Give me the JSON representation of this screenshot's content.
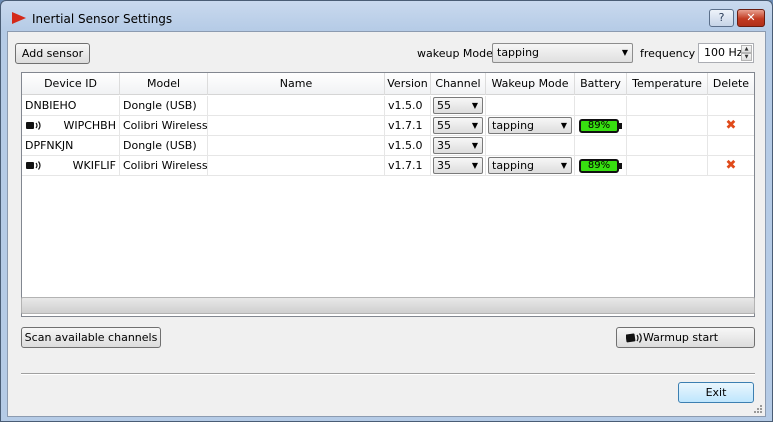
{
  "window": {
    "title": "Inertial Sensor Settings",
    "help_label": "?",
    "close_label": "✕"
  },
  "toolbar": {
    "add_sensor": "Add sensor",
    "wakeup_mode_label": "wakeup Mode",
    "wakeup_mode_value": "tapping",
    "frequency_label": "frequency",
    "frequency_value": "100 Hz"
  },
  "table": {
    "headers": [
      "Device ID",
      "Model",
      "Name",
      "Version",
      "Channel",
      "Wakeup Mode",
      "Battery",
      "Temperature",
      "Delete"
    ],
    "rows": [
      {
        "device_id": "DNBIEHO",
        "model": "Dongle (USB)",
        "name": "",
        "version": "v1.5.0",
        "channel": "55",
        "wakeup_mode": "",
        "battery": "",
        "temperature": "",
        "wireless": false
      },
      {
        "device_id": "WIPCHBH",
        "model": "Colibri Wireless",
        "name": "",
        "version": "v1.7.1",
        "channel": "55",
        "wakeup_mode": "tapping",
        "battery": "89%",
        "temperature": "",
        "wireless": true
      },
      {
        "device_id": "DPFNKJN",
        "model": "Dongle (USB)",
        "name": "",
        "version": "v1.5.0",
        "channel": "35",
        "wakeup_mode": "",
        "battery": "",
        "temperature": "",
        "wireless": false
      },
      {
        "device_id": "WKIFLIF",
        "model": "Colibri Wireless",
        "name": "",
        "version": "v1.7.1",
        "channel": "35",
        "wakeup_mode": "tapping",
        "battery": "89%",
        "temperature": "",
        "wireless": true
      }
    ]
  },
  "footer": {
    "scan_channels": "Scan available channels",
    "warmup_start": "Warmup start",
    "exit": "Exit"
  },
  "icons": {
    "app": "red-play-icon",
    "wireless": "wireless-signal-icon",
    "delete": "x-delete-icon"
  },
  "colors": {
    "battery_fill": "#37e010",
    "delete_x": "#e04a1a",
    "app_icon": "#d42a1a"
  }
}
